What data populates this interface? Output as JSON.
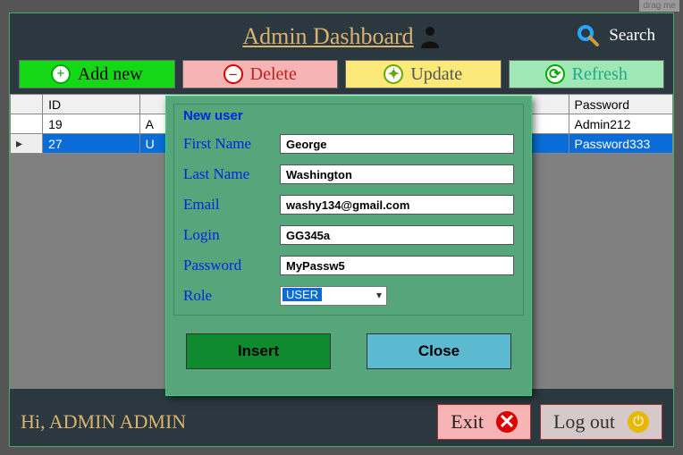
{
  "drag_tag": "drag me",
  "title": "Admin Dashboard",
  "search_label": "Search",
  "toolbar": {
    "add": "Add new",
    "delete": "Delete",
    "update": "Update",
    "refresh": "Refresh"
  },
  "grid": {
    "headers": {
      "id": "ID",
      "password": "Password"
    },
    "rows": [
      {
        "id": "19",
        "rest": "A",
        "password": "Admin212"
      },
      {
        "id": "27",
        "rest": "U",
        "password": "Password333"
      }
    ]
  },
  "footer": {
    "greeting": "Hi, ADMIN ADMIN",
    "exit": "Exit",
    "logout": "Log out"
  },
  "modal": {
    "title": "New user",
    "labels": {
      "first": "First Name",
      "last": "Last Name",
      "email": "Email",
      "login": "Login",
      "password": "Password",
      "role": "Role"
    },
    "values": {
      "first": "George",
      "last": "Washington",
      "email": "washy134@gmail.com",
      "login": "GG345a",
      "password": "MyPassw5",
      "role": "USER"
    },
    "buttons": {
      "insert": "Insert",
      "close": "Close"
    }
  }
}
